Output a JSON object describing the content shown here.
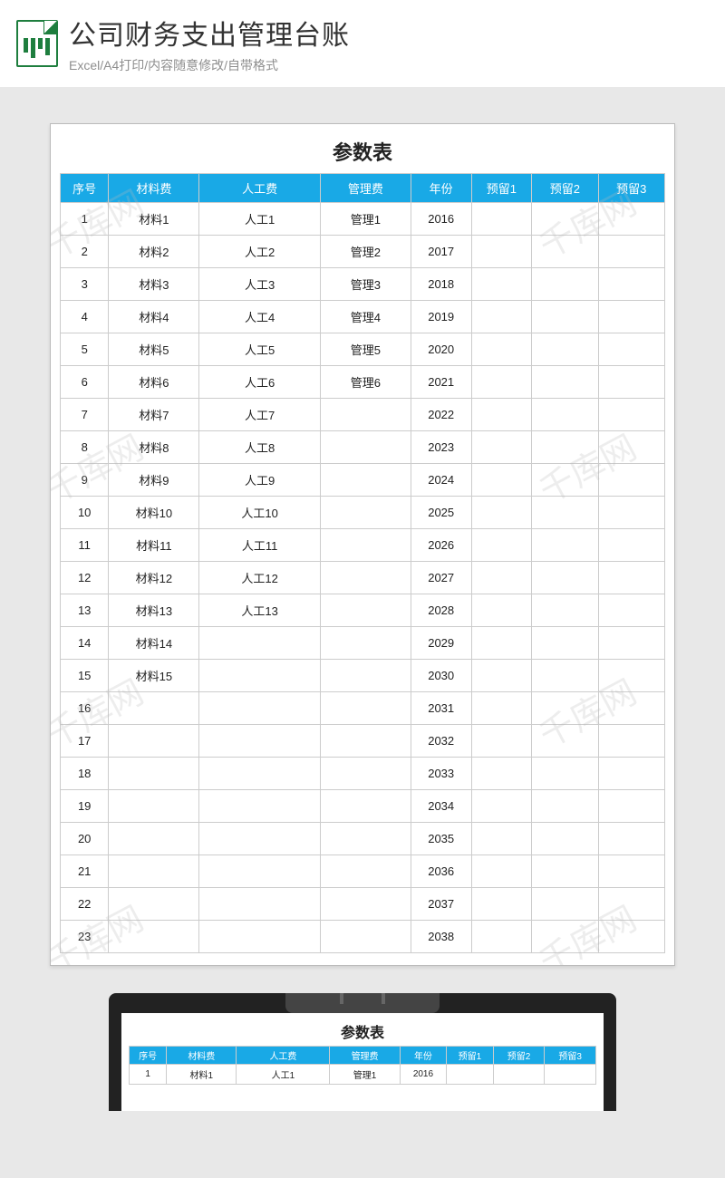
{
  "header": {
    "title": "公司财务支出管理台账",
    "subtitle": "Excel/A4打印/内容随意修改/自带格式"
  },
  "watermark": "千库网",
  "sheet": {
    "title": "参数表",
    "columns": [
      "序号",
      "材料费",
      "人工费",
      "管理费",
      "年份",
      "预留1",
      "预留2",
      "预留3"
    ],
    "col_widths": [
      "8%",
      "15%",
      "20%",
      "15%",
      "10%",
      "10%",
      "11%",
      "11%"
    ],
    "rows": [
      {
        "n": "1",
        "mat": "材料1",
        "lab": "人工1",
        "mgt": "管理1",
        "yr": "2016"
      },
      {
        "n": "2",
        "mat": "材料2",
        "lab": "人工2",
        "mgt": "管理2",
        "yr": "2017"
      },
      {
        "n": "3",
        "mat": "材料3",
        "lab": "人工3",
        "mgt": "管理3",
        "yr": "2018"
      },
      {
        "n": "4",
        "mat": "材料4",
        "lab": "人工4",
        "mgt": "管理4",
        "yr": "2019"
      },
      {
        "n": "5",
        "mat": "材料5",
        "lab": "人工5",
        "mgt": "管理5",
        "yr": "2020"
      },
      {
        "n": "6",
        "mat": "材料6",
        "lab": "人工6",
        "mgt": "管理6",
        "yr": "2021"
      },
      {
        "n": "7",
        "mat": "材料7",
        "lab": "人工7",
        "mgt": "",
        "yr": "2022"
      },
      {
        "n": "8",
        "mat": "材料8",
        "lab": "人工8",
        "mgt": "",
        "yr": "2023"
      },
      {
        "n": "9",
        "mat": "材料9",
        "lab": "人工9",
        "mgt": "",
        "yr": "2024"
      },
      {
        "n": "10",
        "mat": "材料10",
        "lab": "人工10",
        "mgt": "",
        "yr": "2025"
      },
      {
        "n": "11",
        "mat": "材料11",
        "lab": "人工11",
        "mgt": "",
        "yr": "2026"
      },
      {
        "n": "12",
        "mat": "材料12",
        "lab": "人工12",
        "mgt": "",
        "yr": "2027"
      },
      {
        "n": "13",
        "mat": "材料13",
        "lab": "人工13",
        "mgt": "",
        "yr": "2028"
      },
      {
        "n": "14",
        "mat": "材料14",
        "lab": "",
        "mgt": "",
        "yr": "2029"
      },
      {
        "n": "15",
        "mat": "材料15",
        "lab": "",
        "mgt": "",
        "yr": "2030"
      },
      {
        "n": "16",
        "mat": "",
        "lab": "",
        "mgt": "",
        "yr": "2031"
      },
      {
        "n": "17",
        "mat": "",
        "lab": "",
        "mgt": "",
        "yr": "2032"
      },
      {
        "n": "18",
        "mat": "",
        "lab": "",
        "mgt": "",
        "yr": "2033"
      },
      {
        "n": "19",
        "mat": "",
        "lab": "",
        "mgt": "",
        "yr": "2034"
      },
      {
        "n": "20",
        "mat": "",
        "lab": "",
        "mgt": "",
        "yr": "2035"
      },
      {
        "n": "21",
        "mat": "",
        "lab": "",
        "mgt": "",
        "yr": "2036"
      },
      {
        "n": "22",
        "mat": "",
        "lab": "",
        "mgt": "",
        "yr": "2037"
      },
      {
        "n": "23",
        "mat": "",
        "lab": "",
        "mgt": "",
        "yr": "2038"
      }
    ]
  },
  "clip": {
    "visible_rows": 1
  }
}
